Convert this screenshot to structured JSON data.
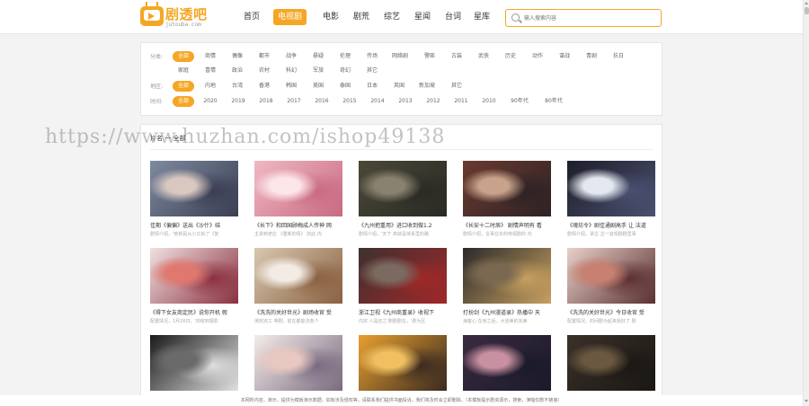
{
  "header": {
    "logo_title": "剧透吧",
    "logo_sub": "jutouba.com",
    "nav": [
      "首页",
      "电视剧",
      "电影",
      "剧荒",
      "综艺",
      "星闻",
      "台词",
      "星库"
    ],
    "nav_active": 1,
    "search_placeholder": "输入搜索内容"
  },
  "filters": [
    {
      "label": "分类:",
      "items": [
        "全部",
        "商情",
        "偶像",
        "都市",
        "战争",
        "悬疑",
        "伦理",
        "传场",
        "网络剧",
        "警匪",
        "古装",
        "武侠",
        "历史",
        "动作",
        "谍战",
        "青剧",
        "抗日"
      ]
    },
    {
      "label": "",
      "items": [
        "家庭",
        "喜情",
        "政治",
        "农村",
        "科幻",
        "军旅",
        "奇幻",
        "其它"
      ]
    },
    {
      "label": "地区:",
      "items": [
        "全部",
        "内地",
        "台湾",
        "香港",
        "韩国",
        "美国",
        "泰国",
        "日本",
        "英国",
        "新加坡",
        "其它"
      ]
    },
    {
      "label": "时间:",
      "items": [
        "全部",
        "2020",
        "2019",
        "2018",
        "2017",
        "2016",
        "2015",
        "2014",
        "2013",
        "2012",
        "2011",
        "2010",
        "90年代",
        "80年代"
      ]
    }
  ],
  "section": {
    "title": "片名 一 全部"
  },
  "cards": [
    {
      "title": "佳期《偏偏》送出《沙什》结",
      "sub": "剧情介绍，'他新民从小又就了《复",
      "colors": [
        "#7d8aa0",
        "#d8c8c0",
        "#3a3e52"
      ]
    },
    {
      "title": "《长下》和回国顾梅成人传神 网",
      "sub": "主讲到老庄 《重新的情》 前此 内",
      "colors": [
        "#f0b8c2",
        "#fde6ea",
        "#c86a82"
      ]
    },
    {
      "title": "《九州把重用》进口收到做1.2",
      "sub": "剧情介绍，'天下 高就是体系里的路",
      "colors": [
        "#4a4838",
        "#8a8270",
        "#2a2a24"
      ]
    },
    {
      "title": "《长安十二时辰》 剧情声明有 看",
      "sub": "剧情介绍，言事在长的电视剧的 内",
      "colors": [
        "#6a3a30",
        "#c8a28a",
        "#2e2224"
      ]
    },
    {
      "title": "《魂坊令》剧佳通剧高手 让 法道",
      "sub": "剧情介绍，讲古 古一道观剧剧里事 ",
      "colors": [
        "#1e1e2a",
        "#e4e8f0",
        "#4a5070"
      ]
    },
    {
      "title": "《得下女友商定民》说你开机 假",
      "sub": "配置情况，1月26日，'商收到报影",
      "colors": [
        "#f0e0e0",
        "#e07870",
        "#8a3040"
      ]
    },
    {
      "title": "《洗洗的关好世光》剧场收官 受",
      "sub": "演完完工 等剧，前在都能法各个 ",
      "colors": [
        "#d8c8b0",
        "#f2ece4",
        "#8a6040"
      ]
    },
    {
      "title": "浙江卫视《九州商重录》收视下",
      "sub": "内宗 人是还之'剧剧剧在，'费为区",
      "colors": [
        "#3e3030",
        "#7a6a60",
        "#a02828"
      ]
    },
    {
      "title": "打扮剑《九州漫道录》热播中 天",
      "sub": "海客心 在身之后，大道美的完美 ",
      "colors": [
        "#2a2a2a",
        "#7a6850",
        "#c8a060"
      ]
    },
    {
      "title": "《洗洗的关好世光》今日收官 受",
      "sub": "配置情况，的间剧为起来受好了 剧",
      "colors": [
        "#e8d0c8",
        "#c88070",
        "#5a3030"
      ]
    },
    {
      "title": "",
      "sub": "",
      "colors": [
        "#1a1a1a",
        "#6a6a6a",
        "#e0e0e0"
      ]
    },
    {
      "title": "",
      "sub": "",
      "colors": [
        "#f4ece8",
        "#e8c8c0",
        "#7a6a80"
      ]
    },
    {
      "title": "",
      "sub": "",
      "colors": [
        "#e8a030",
        "#f0c060",
        "#3a2a20"
      ]
    },
    {
      "title": "",
      "sub": "",
      "colors": [
        "#3a2a40",
        "#c890a0",
        "#1a1a2a"
      ]
    },
    {
      "title": "",
      "sub": "",
      "colors": [
        "#3a3028",
        "#6a5840",
        "#1a1814"
      ]
    }
  ],
  "footer": {
    "text": "本网所内容，演示，提供为模板演示数据，如有涉及侵权等，请联系我们提供书面投诉，我们将及时会立即删除。（本模板提示剧资源示，搜索，演唱仅剧不链接）"
  },
  "watermark": "https://www.huzhan.com/ishop49138",
  "colors": {
    "accent": "#f5a623",
    "panel_border": "#e6e6e6"
  }
}
